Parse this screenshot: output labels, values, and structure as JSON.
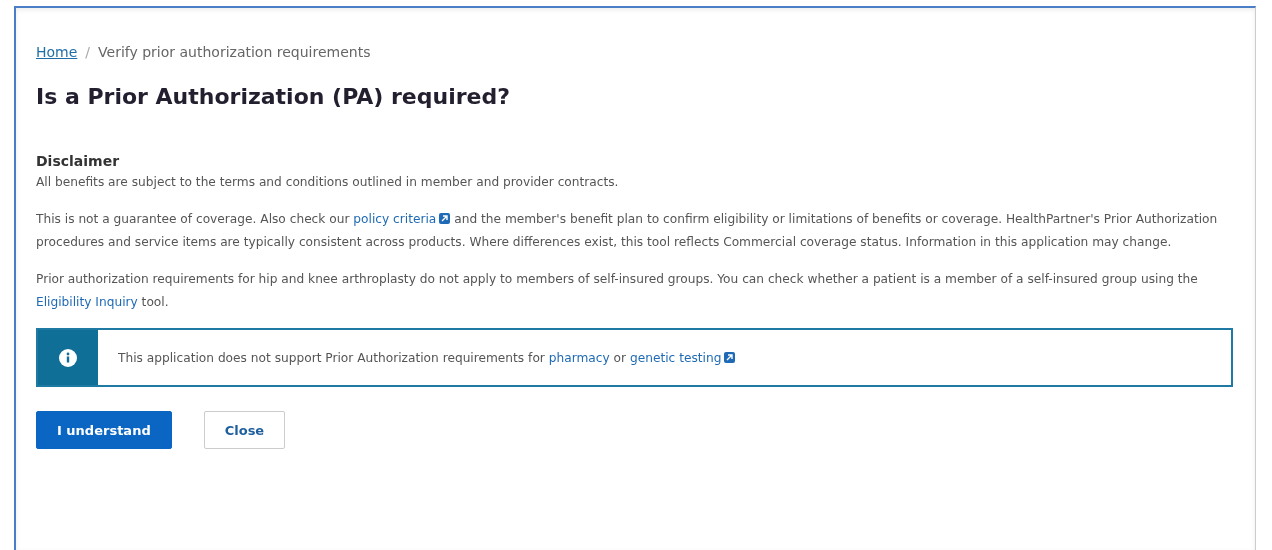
{
  "breadcrumb": {
    "home": "Home",
    "separator": "/",
    "current": "Verify prior authorization requirements"
  },
  "title": "Is a Prior Authorization (PA) required?",
  "disclaimer": {
    "heading": "Disclaimer",
    "paragraphs": [
      [
        {
          "kind": "text",
          "text": "All benefits are subject to the terms and conditions outlined in member and provider contracts."
        }
      ],
      [
        {
          "kind": "text",
          "text": "This is not a guarantee of coverage. Also check our "
        },
        {
          "kind": "link",
          "text": "policy criteria",
          "external": true
        },
        {
          "kind": "text",
          "text": " and the member's benefit plan to confirm eligibility or limitations of benefits or coverage. HealthPartner's Prior Authorization procedures and service items are typically consistent across products. Where differences exist, this tool reflects Commercial coverage status. Information in this application may change."
        }
      ],
      [
        {
          "kind": "text",
          "text": "Prior authorization requirements for hip and knee arthroplasty do not apply to members of self-insured groups. You can check whether a patient is a member of a self-insured group using the "
        },
        {
          "kind": "link",
          "text": "Eligibility Inquiry",
          "external": false
        },
        {
          "kind": "text",
          "text": " tool."
        }
      ]
    ]
  },
  "notice": [
    {
      "kind": "text",
      "text": "This application does not support Prior Authorization requirements for "
    },
    {
      "kind": "link",
      "text": "pharmacy",
      "external": false
    },
    {
      "kind": "text",
      "text": " or "
    },
    {
      "kind": "link",
      "text": "genetic testing",
      "external": true
    }
  ],
  "buttons": [
    {
      "label": "I understand",
      "kind": "primary"
    },
    {
      "label": "Close",
      "kind": "secondary"
    }
  ]
}
